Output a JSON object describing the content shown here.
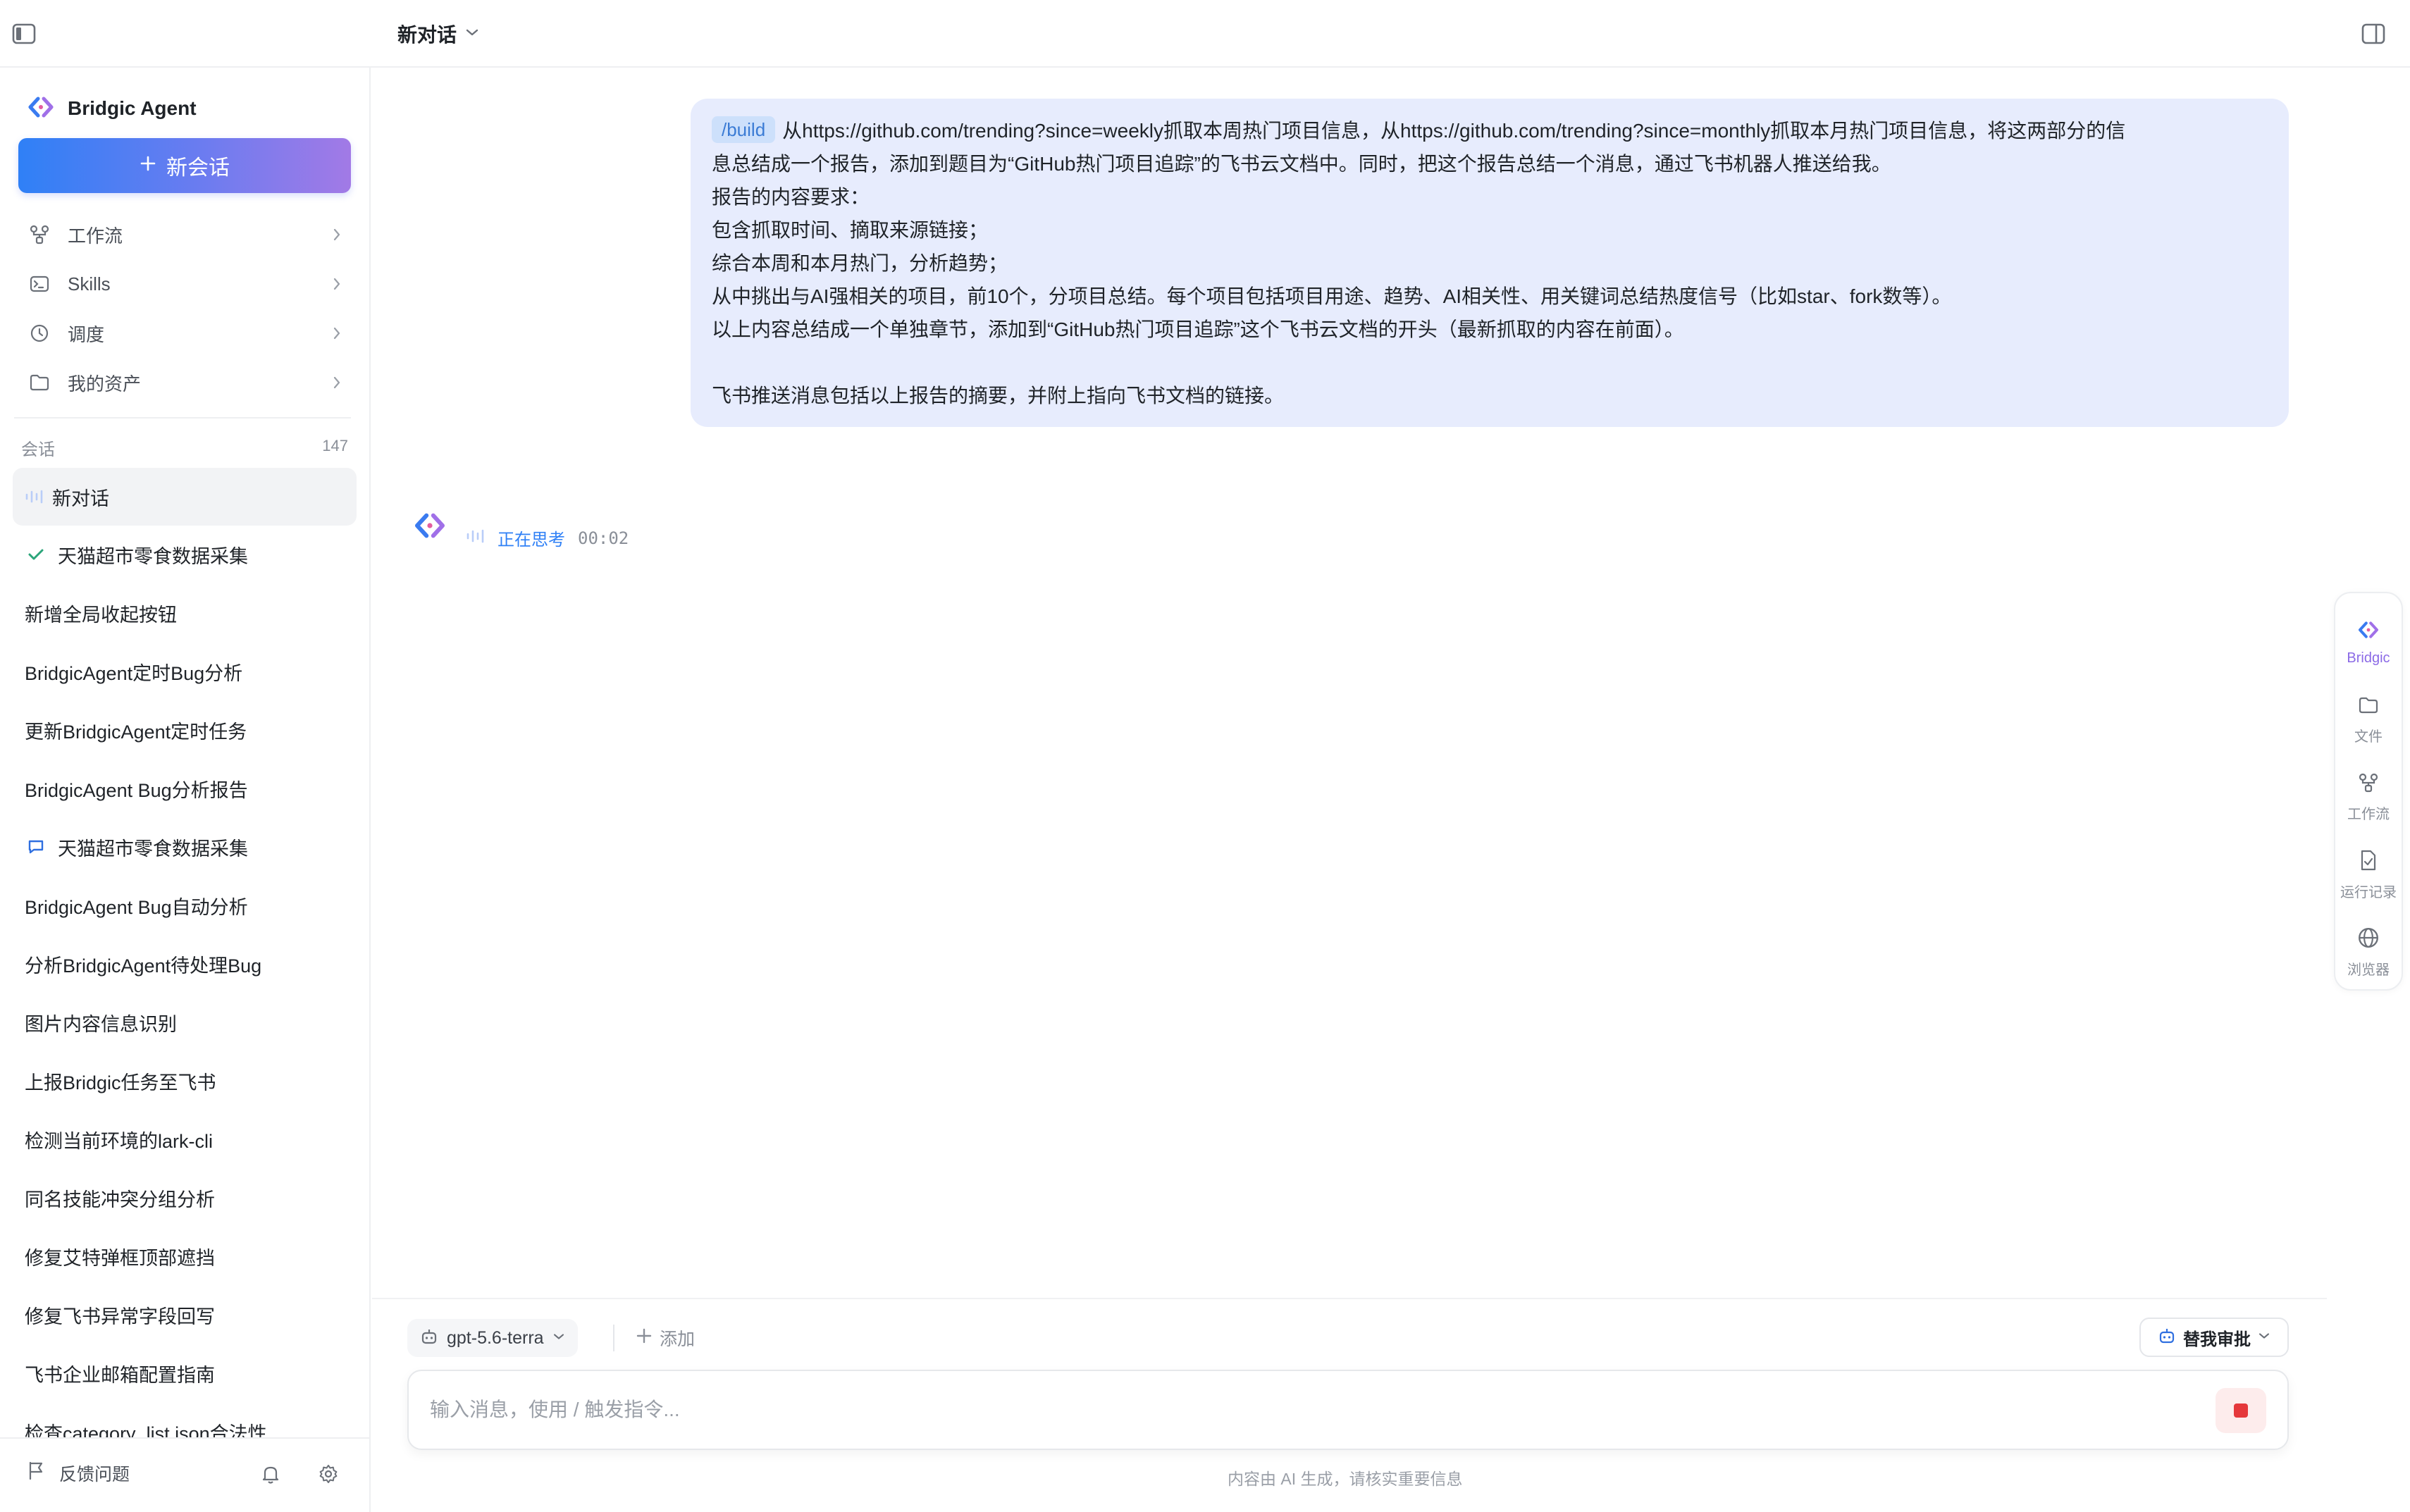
{
  "header": {
    "title": "新对话"
  },
  "sidebar": {
    "brand": "Bridgic Agent",
    "new_chat": "新会话",
    "nav": [
      {
        "label": "工作流",
        "icon": "workflow-icon"
      },
      {
        "label": "Skills",
        "icon": "terminal-icon"
      },
      {
        "label": "调度",
        "icon": "clock-icon"
      },
      {
        "label": "我的资产",
        "icon": "folder-icon"
      }
    ],
    "section": {
      "label": "会话",
      "count": "147"
    },
    "conversations": [
      {
        "label": "新对话",
        "status": "active"
      },
      {
        "label": "天猫超市零食数据采集",
        "status": "done"
      },
      {
        "label": "新增全局收起按钮",
        "status": ""
      },
      {
        "label": "BridgicAgent定时Bug分析",
        "status": ""
      },
      {
        "label": "更新BridgicAgent定时任务",
        "status": ""
      },
      {
        "label": "BridgicAgent Bug分析报告",
        "status": ""
      },
      {
        "label": "天猫超市零食数据采集",
        "status": "message"
      },
      {
        "label": "BridgicAgent Bug自动分析",
        "status": ""
      },
      {
        "label": "分析BridgicAgent待处理Bug",
        "status": ""
      },
      {
        "label": "图片内容信息识别",
        "status": ""
      },
      {
        "label": "上报Bridgic任务至飞书",
        "status": ""
      },
      {
        "label": "检测当前环境的lark-cli",
        "status": ""
      },
      {
        "label": "同名技能冲突分组分析",
        "status": ""
      },
      {
        "label": "修复艾特弹框顶部遮挡",
        "status": ""
      },
      {
        "label": "修复飞书异常字段回写",
        "status": ""
      },
      {
        "label": "飞书企业邮箱配置指南",
        "status": ""
      },
      {
        "label": "检查category_list.json合法性",
        "status": ""
      }
    ],
    "footer": {
      "feedback": "反馈问题"
    }
  },
  "chat": {
    "user_message": {
      "command": "/build",
      "lines": [
        "从https://github.com/trending?since=weekly抓取本周热门项目信息，从https://github.com/trending?since=monthly抓取本月热门项目信息，将这两部分的信",
        "息总结成一个报告，添加到题目为“GitHub热门项目追踪”的飞书云文档中。同时，把这个报告总结一个消息，通过飞书机器人推送给我。",
        "报告的内容要求：",
        "包含抓取时间、摘取来源链接；",
        "综合本周和本月热门，分析趋势；",
        "从中挑出与AI强相关的项目，前10个，分项目总结。每个项目包括项目用途、趋势、AI相关性、用关键词总结热度信号（比如star、fork数等）。",
        "以上内容总结成一个单独章节，添加到“GitHub热门项目追踪”这个飞书云文档的开头（最新抓取的内容在前面）。",
        "",
        "飞书推送消息包括以上报告的摘要，并附上指向飞书文档的链接。"
      ]
    },
    "thinking": {
      "label": "正在思考",
      "time": "00:02"
    }
  },
  "right_rail": [
    {
      "label": "Bridgic",
      "icon": "bridgic-logo-icon",
      "active": true
    },
    {
      "label": "文件",
      "icon": "folder-icon",
      "active": false
    },
    {
      "label": "工作流",
      "icon": "workflow-icon",
      "active": false
    },
    {
      "label": "运行记录",
      "icon": "run-log-icon",
      "active": false
    },
    {
      "label": "浏览器",
      "icon": "globe-icon",
      "active": false
    }
  ],
  "composer": {
    "model": "gpt-5.6-terra",
    "add": "添加",
    "approval": "替我审批",
    "placeholder": "输入消息，使用 / 触发指令...",
    "disclaimer": "内容由 AI 生成，请核实重要信息"
  },
  "colors": {
    "accent": "#2f80f6",
    "accent_purple": "#a27ae6",
    "bubble": "#e7ecfd",
    "stop": "#e5383b"
  }
}
